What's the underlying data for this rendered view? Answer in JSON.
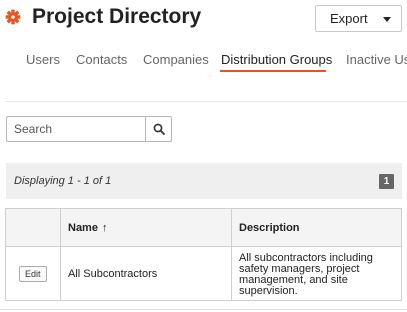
{
  "header": {
    "title": "Project Directory",
    "icon": "gear-icon",
    "accent_color": "#e8531e"
  },
  "export": {
    "label": "Export"
  },
  "tabs": [
    {
      "label": "Users"
    },
    {
      "label": "Contacts"
    },
    {
      "label": "Companies"
    },
    {
      "label": "Distribution Groups",
      "active": true
    },
    {
      "label": "Inactive Use"
    }
  ],
  "search": {
    "placeholder": "Search",
    "value": ""
  },
  "pagination": {
    "summary": "Displaying 1 - 1 of 1",
    "current_page": "1"
  },
  "table": {
    "columns": [
      "",
      "Name",
      "Description"
    ],
    "sort_indicator": "↑",
    "rows": [
      {
        "action": "Edit",
        "name": "All Subcontractors",
        "description": "All subcontractors including safety managers, project management, and site supervision."
      }
    ]
  }
}
